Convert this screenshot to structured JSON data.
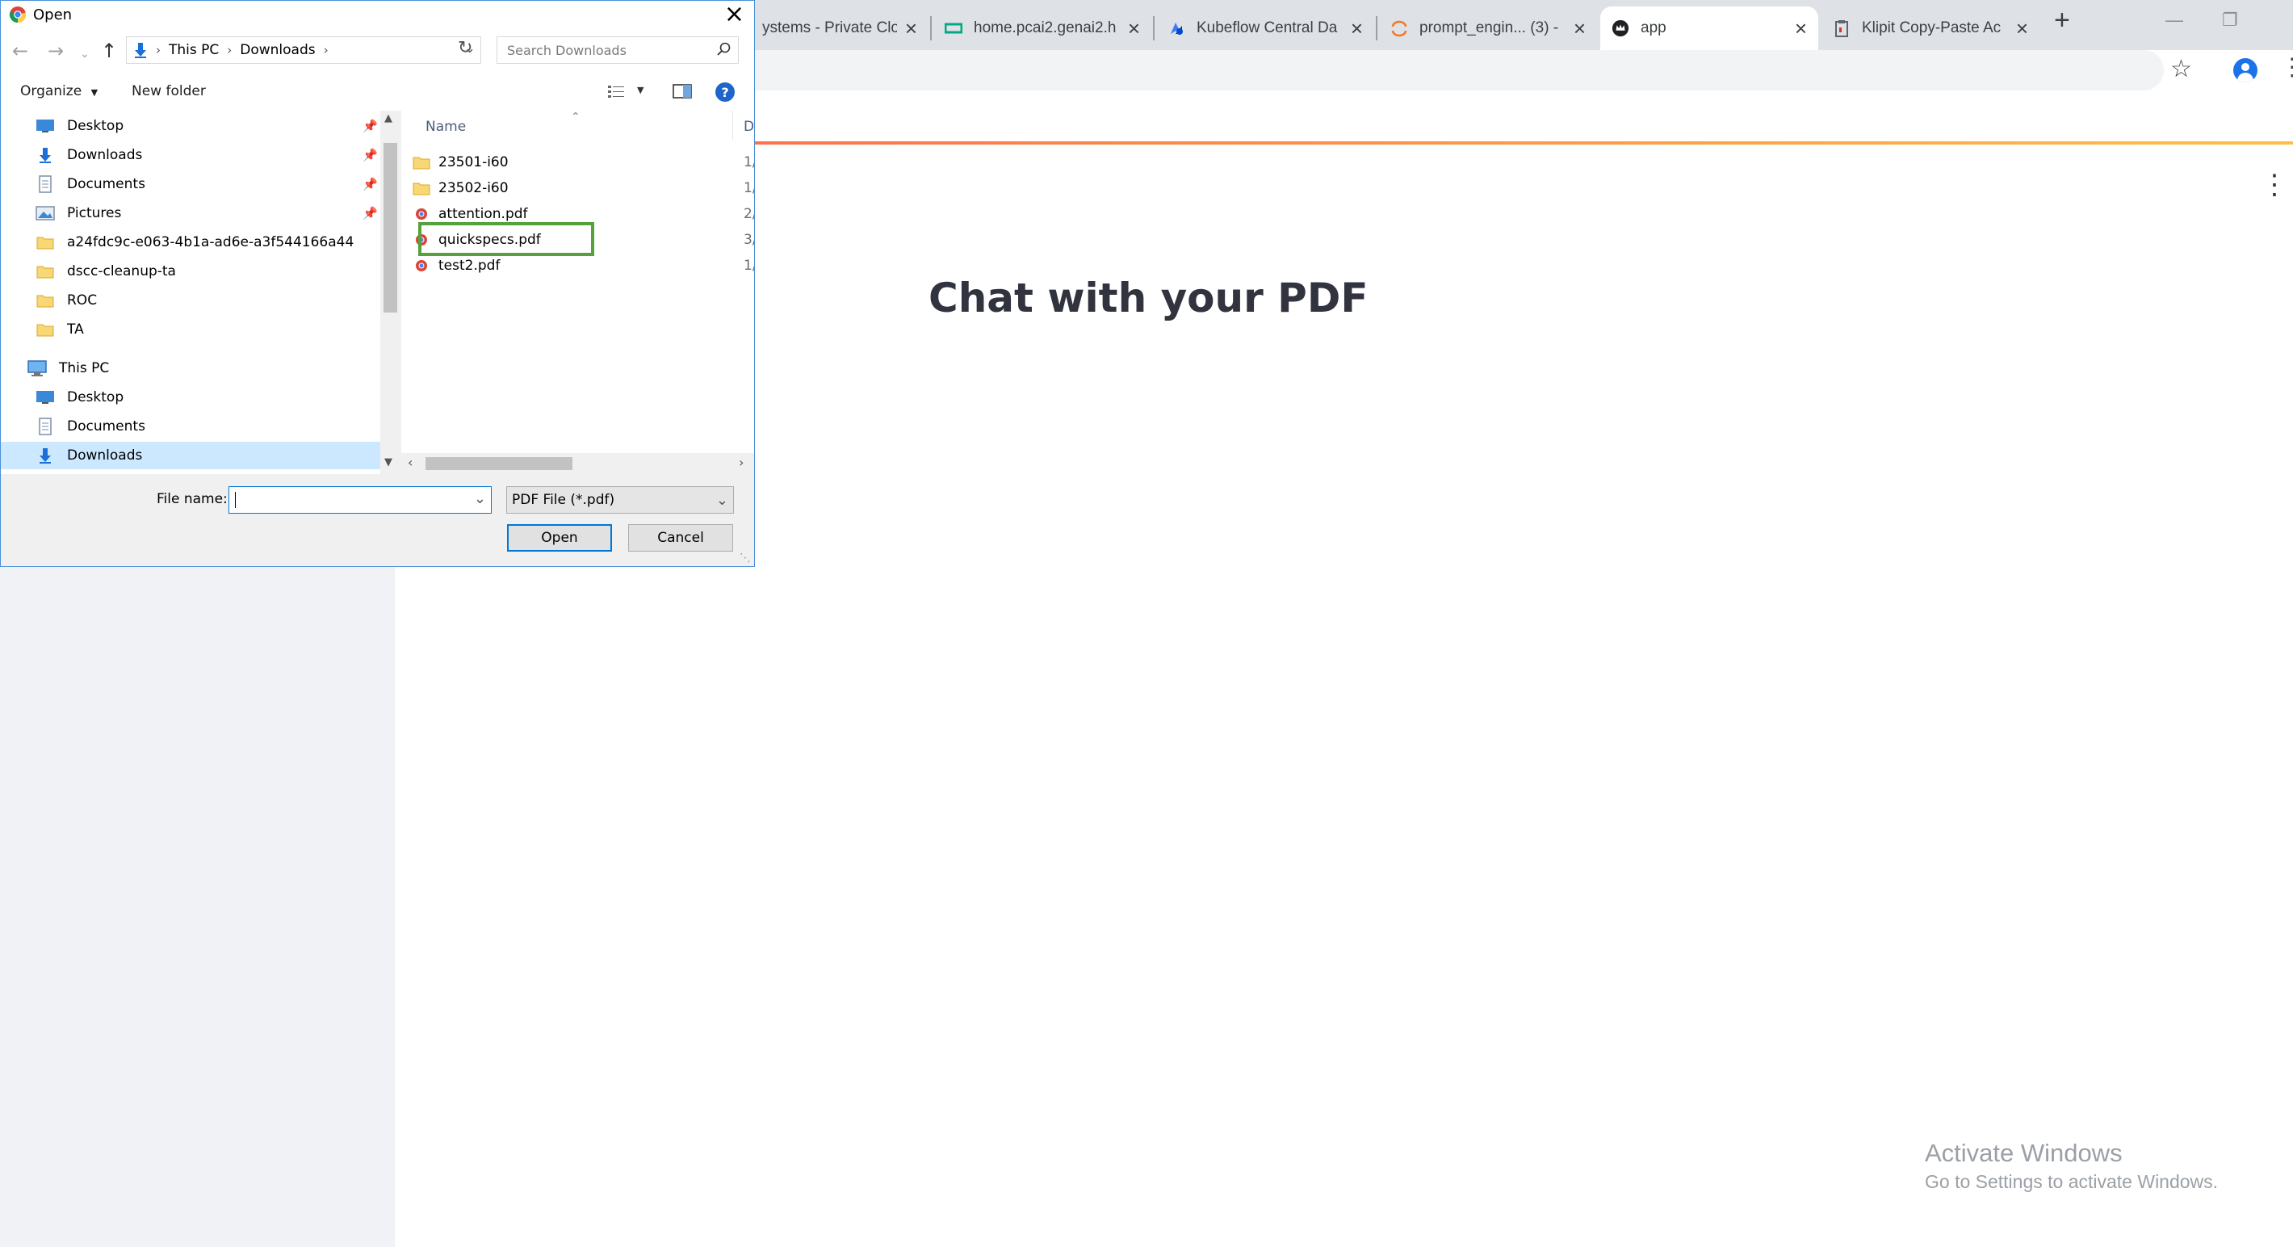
{
  "browser": {
    "tabs": [
      {
        "title": "ystems - Private Clo",
        "icon": "page-icon"
      },
      {
        "title": "home.pcai2.genai2.h",
        "icon": "hpe-logo-icon"
      },
      {
        "title": "Kubeflow Central Da",
        "icon": "kubeflow-icon"
      },
      {
        "title": "prompt_engin... (3) -",
        "icon": "jupyter-icon"
      },
      {
        "title": "app",
        "icon": "streamlit-crown-icon",
        "active": true
      },
      {
        "title": "Klipit Copy-Paste Ac",
        "icon": "clipboard-icon"
      }
    ],
    "new_tab": "+",
    "close_glyph": "×"
  },
  "page": {
    "title": "Chat with your PDF",
    "menu_icon": "⋮"
  },
  "watermark": {
    "title": "Activate Windows",
    "subtitle": "Go to Settings to activate Windows."
  },
  "dialog": {
    "title": "Open",
    "breadcrumb": [
      "This PC",
      "Downloads"
    ],
    "search_placeholder": "Search Downloads",
    "organize_label": "Organize",
    "new_folder_label": "New folder",
    "nav_items": [
      {
        "label": "Desktop",
        "icon": "desktop-icon",
        "pinned": true
      },
      {
        "label": "Downloads",
        "icon": "download-arrow-icon",
        "pinned": true
      },
      {
        "label": "Documents",
        "icon": "documents-icon",
        "pinned": true
      },
      {
        "label": "Pictures",
        "icon": "pictures-icon",
        "pinned": true
      },
      {
        "label": "a24fdc9c-e063-4b1a-ad6e-a3f544166a44",
        "icon": "folder-icon"
      },
      {
        "label": "dscc-cleanup-ta",
        "icon": "folder-icon"
      },
      {
        "label": "ROC",
        "icon": "folder-icon"
      },
      {
        "label": "TA",
        "icon": "folder-icon"
      },
      {
        "label": "This PC",
        "icon": "computer-icon"
      },
      {
        "label": "Desktop",
        "icon": "desktop-icon"
      },
      {
        "label": "Documents",
        "icon": "documents-icon"
      },
      {
        "label": "Downloads",
        "icon": "download-arrow-icon",
        "selected": true
      }
    ],
    "column_name": "Name",
    "column_date": "D",
    "files": [
      {
        "name": "23501-i60",
        "icon": "folder-icon",
        "date": "1/"
      },
      {
        "name": "23502-i60",
        "icon": "folder-icon",
        "date": "1/"
      },
      {
        "name": "attention.pdf",
        "icon": "pdf-icon",
        "date": "2/"
      },
      {
        "name": "quickspecs.pdf",
        "icon": "pdf-icon",
        "date": "3/",
        "highlighted": true
      },
      {
        "name": "test2.pdf",
        "icon": "pdf-icon",
        "date": "1/"
      }
    ],
    "file_name_label": "File name:",
    "file_name_value": "",
    "file_type": "PDF File (*.pdf)",
    "open_label": "Open",
    "cancel_label": "Cancel"
  },
  "colors": {
    "highlight_border": "#55a13d",
    "streamlit_gradient_start": "#ff4b4b",
    "streamlit_gradient_end": "#ffbd45",
    "sidebar_bg": "#f0f2f6",
    "selected_nav_bg": "#cce8ff"
  }
}
